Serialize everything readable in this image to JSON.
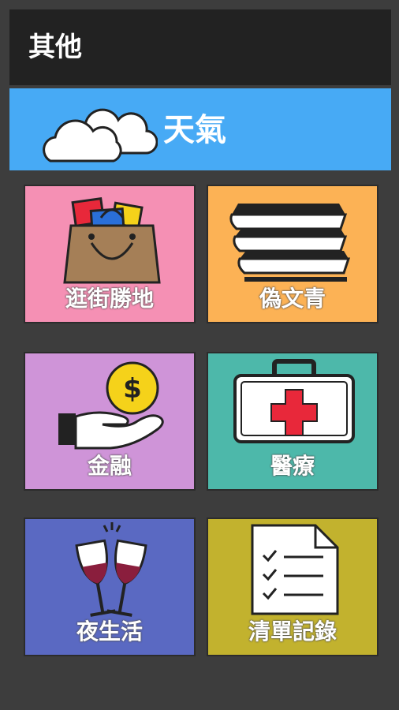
{
  "header": {
    "title": "其他"
  },
  "weather": {
    "label": "天氣",
    "icon": "cloud-icon"
  },
  "tiles": [
    {
      "label": "逛街勝地",
      "icon": "shopping-bag-icon",
      "color": "#f590b4"
    },
    {
      "label": "偽文青",
      "icon": "books-icon",
      "color": "#fcb255"
    },
    {
      "label": "金融",
      "icon": "money-hand-icon",
      "color": "#cf94d8"
    },
    {
      "label": "醫療",
      "icon": "first-aid-kit-icon",
      "color": "#4db8aa"
    },
    {
      "label": "夜生活",
      "icon": "wine-glasses-icon",
      "color": "#5a69c2"
    },
    {
      "label": "清單記錄",
      "icon": "checklist-icon",
      "color": "#c2b22e"
    }
  ],
  "money_symbol": "$"
}
